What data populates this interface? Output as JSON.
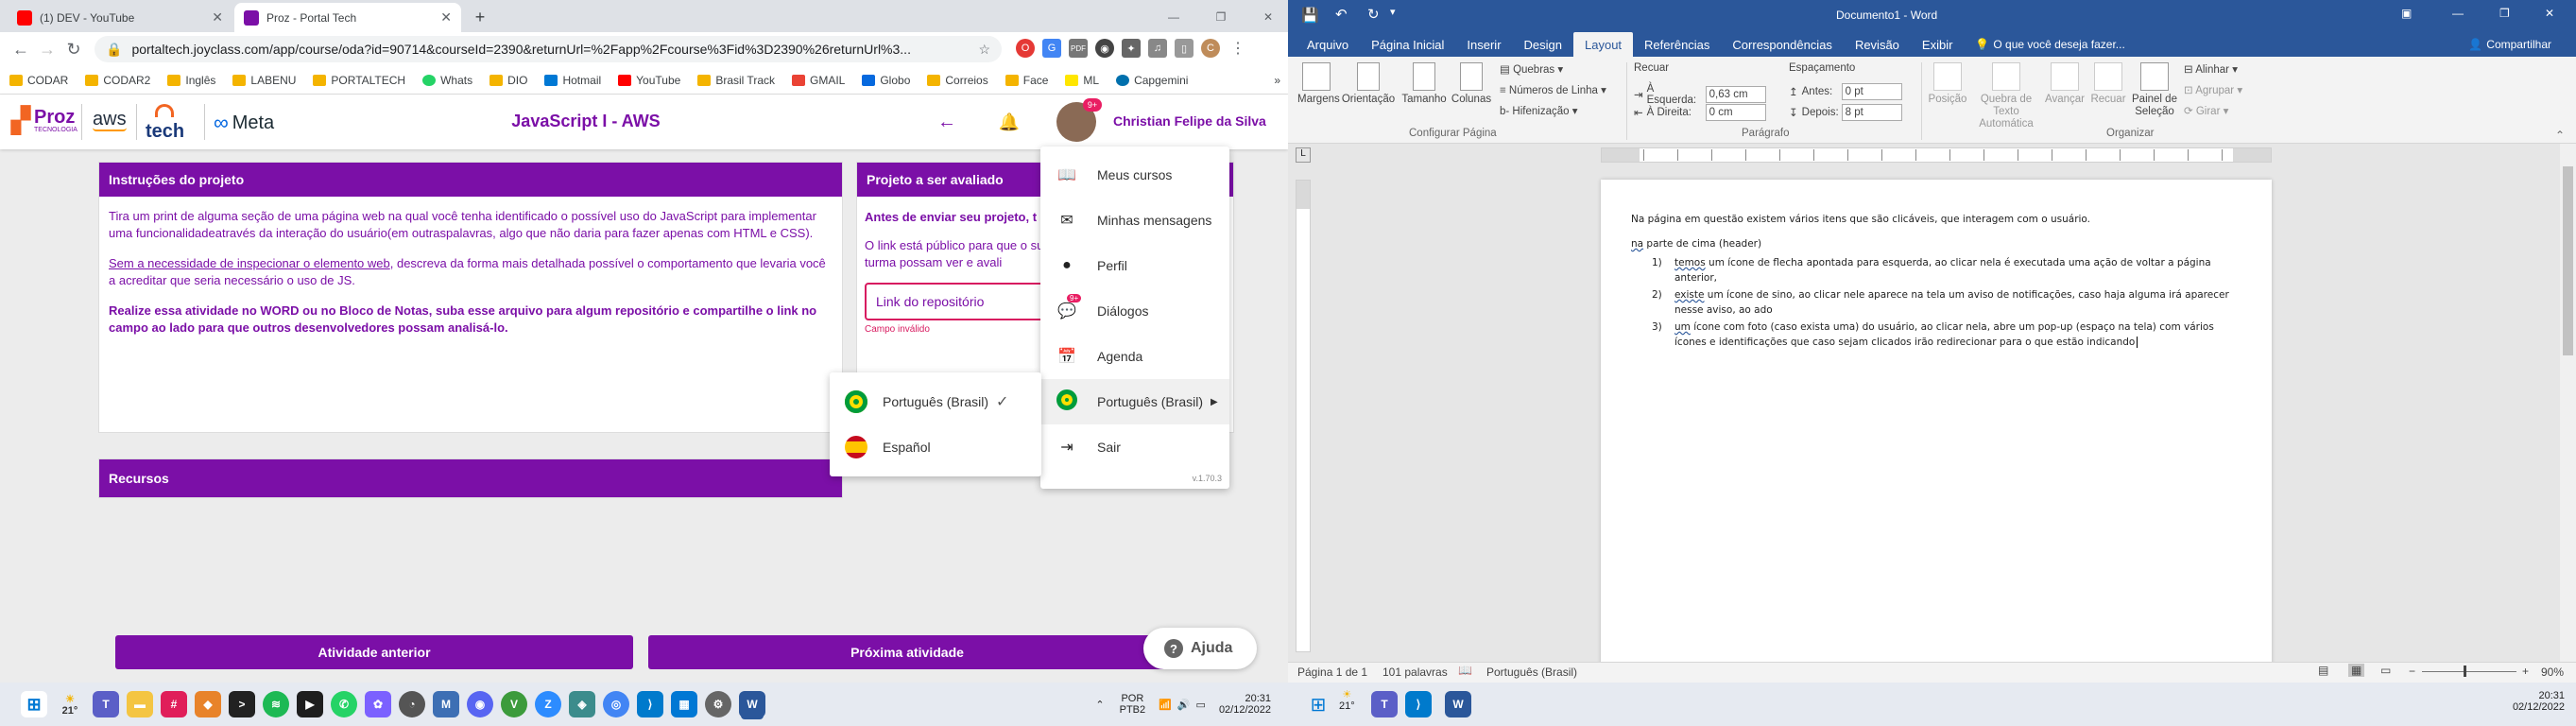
{
  "browser": {
    "tabs": [
      {
        "title": "(1) DEV - YouTube",
        "favicon_color": "#ff0000"
      },
      {
        "title": "Proz - Portal Tech",
        "favicon_color": "#7b0fa7"
      }
    ],
    "url": "portaltech.joyclass.com/app/course/oda?id=90714&courseId=2390&returnUrl=%2Fapp%2Fcourse%3Fid%3D2390%26returnUrl%3...",
    "bookmarks": [
      "CODAR",
      "CODAR2",
      "Inglês",
      "LABENU",
      "PORTALTECH",
      "Whats",
      "DIO",
      "Hotmail",
      "YouTube",
      "Brasil Track",
      "GMAIL",
      "Globo",
      "Correios",
      "Face",
      "ML",
      "Capgemini"
    ],
    "bookmarks_more": "»"
  },
  "site": {
    "logos": {
      "proz": "Proz",
      "proz_sub": "TECNOLOGIA",
      "aws": "aws",
      "tech": "tech",
      "meta": "Meta"
    },
    "title": "JavaScript I - AWS",
    "user_name": "Christian Felipe da Silva",
    "avatar_badge": "9+",
    "instructions": {
      "header": "Instruções do projeto",
      "p1": "Tira um print de alguma seção de uma página web na qual você tenha identificado o possível uso do JavaScript para implementar uma funcionalidadeatravés da interação do usuário(em outraspalavras, algo que não daria para fazer apenas com HTML e CSS).",
      "p2_link": "Sem a necessidade de inspecionar o elemento web",
      "p2_rest": ", descreva da forma mais detalhada possível o comportamento que levaria você a acreditar que seria necessário o uso de JS.",
      "p3": "Realize essa atividade no WORD ou no Bloco de Notas, suba esse arquivo para algum repositório e compartilhe o link no campo ao lado para que outros desenvolvedores possam analisá-lo."
    },
    "project": {
      "header": "Projeto a ser avaliado",
      "bold": "Antes de enviar seu projeto, t",
      "text": "O link está público para que o sua turma possam ver e avali",
      "placeholder": "Link do repositório",
      "error": "Campo inválido"
    },
    "resources_header": "Recursos",
    "prev_button": "Atividade anterior",
    "next_button": "Próxima atividade",
    "help_button": "Ajuda",
    "menu": {
      "items": [
        "Meus cursos",
        "Minhas mensagens",
        "Perfil",
        "Diálogos",
        "Agenda",
        "Português (Brasil)",
        "Sair"
      ],
      "dialogs_badge": "9+",
      "version": "v.1.70.3"
    },
    "languages": [
      {
        "label": "Português (Brasil)",
        "selected": true
      },
      {
        "label": "Español",
        "selected": false
      }
    ]
  },
  "taskbar_left": {
    "weather": "21°",
    "lang": "POR",
    "lang2": "PTB2",
    "time": "20:31",
    "date": "02/12/2022"
  },
  "word": {
    "autosave_label": "Documento1 - Word",
    "share": "Compartilhar",
    "tabs": [
      "Arquivo",
      "Página Inicial",
      "Inserir",
      "Design",
      "Layout",
      "Referências",
      "Correspondências",
      "Revisão",
      "Exibir"
    ],
    "tell_me": "O que você deseja fazer...",
    "ribbon": {
      "margens": "Margens",
      "orientacao": "Orientação",
      "tamanho": "Tamanho",
      "colunas": "Colunas",
      "quebras": "Quebras",
      "numeros": "Números de Linha",
      "hifenizacao": "Hifenização",
      "recuar": "Recuar",
      "esquerda_label": "À Esquerda:",
      "esquerda_val": "0,63 cm",
      "direita_label": "À Direita:",
      "direita_val": "0 cm",
      "espacamento": "Espaçamento",
      "antes_label": "Antes:",
      "antes_val": "0 pt",
      "depois_label": "Depois:",
      "depois_val": "8 pt",
      "posicao": "Posição",
      "quebra_texto": "Quebra de Texto Automática",
      "avancar": "Avançar",
      "recuar2": "Recuar",
      "painel": "Painel de Seleção",
      "alinhar": "Alinhar",
      "agrupar": "Agrupar",
      "girar": "Girar",
      "grp_config": "Configurar Página",
      "grp_paragrafo": "Parágrafo",
      "grp_organizar": "Organizar"
    },
    "doc": {
      "intro": "Na página em questão existem vários itens que são clicáveis, que interagem com o usuário.",
      "header_line_a": "na",
      "header_line_b": " parte de cima (header)",
      "items": [
        {
          "num": "1)",
          "first": "temos",
          "line1": " um ícone de flecha apontada para esquerda, ao clicar nela é executada uma ação de voltar a página",
          "line2": "anterior,"
        },
        {
          "num": "2)",
          "first": "existe",
          "line1": " um ícone de sino, ao clicar nele aparece na tela um aviso de notificações, caso haja alguma irá aparecer",
          "line2": "nesse aviso, ao ado"
        },
        {
          "num": "3)",
          "first": "um",
          "line1": " ícone com foto (caso exista uma) do usuário, ao clicar nela, abre um pop-up (espaço na tela) com vários",
          "line2": "ícones e identificações que caso sejam clicados irão redirecionar para o que estão indicando"
        }
      ]
    },
    "status": {
      "page": "Página 1 de 1",
      "words": "101 palavras",
      "lang": "Português (Brasil)",
      "zoom": "90%"
    }
  },
  "taskbar_right": {
    "weather": "21°",
    "time": "20:31",
    "date": "02/12/2022"
  },
  "colors": {
    "purple": "#7b0fa7",
    "word_blue": "#2b579a"
  }
}
